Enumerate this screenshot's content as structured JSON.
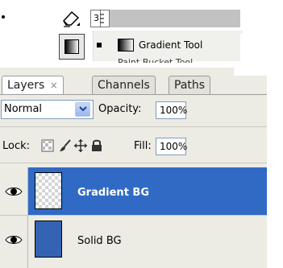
{
  "tools": {
    "size_value": "3",
    "menu_item_label": "Gradient Tool",
    "menu_item_cut": "Paint Bucket Tool"
  },
  "panel": {
    "tabs": [
      {
        "label": "Layers",
        "close": "×",
        "active": true
      },
      {
        "label": "Channels",
        "active": false
      },
      {
        "label": "Paths",
        "active": false
      }
    ],
    "blend_mode": "Normal",
    "opacity_label": "Opacity:",
    "opacity_value": "100%",
    "lock_label": "Lock:",
    "fill_label": "Fill:",
    "fill_value": "100%"
  },
  "layers": [
    {
      "name": "Gradient BG",
      "selected": true,
      "thumbnail": "transparent-checker"
    },
    {
      "name": "Solid BG",
      "selected": false,
      "thumbnail": "solid-blue"
    }
  ],
  "colors": {
    "selection": "#316ac5",
    "solid_layer": "#3563b3",
    "panel_bg": "#ecebe4"
  },
  "icons": [
    "eraser-icon",
    "gradient-tool-icon",
    "lock-transparent-icon",
    "lock-brush-icon",
    "lock-move-icon",
    "lock-all-icon",
    "eye-icon",
    "chevron-down-icon"
  ]
}
